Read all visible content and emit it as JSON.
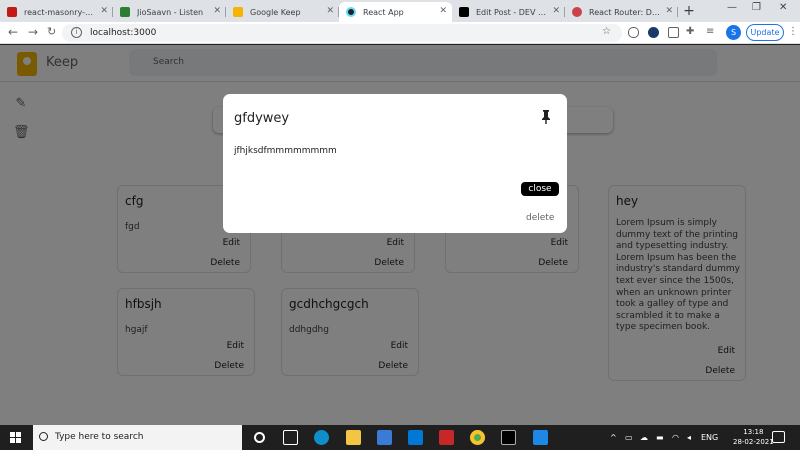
{
  "browser": {
    "tabs": [
      {
        "label": "react-masonry-css - n",
        "color": "#c41a16"
      },
      {
        "label": "JioSaavn - Listen",
        "color": "#2e7d32"
      },
      {
        "label": "Google Keep",
        "color": "#f4b400"
      },
      {
        "label": "React App",
        "color": "#61dafb"
      },
      {
        "label": "Edit Post - DEV Comm",
        "color": "#000000"
      },
      {
        "label": "React Router: Declar",
        "color": "#ca4245"
      }
    ],
    "new_tab": "+",
    "url": "localhost:3000",
    "profile_initial": "S",
    "update_label": "Update"
  },
  "app": {
    "brand": "Keep",
    "search_placeholder": "Search",
    "notes": [
      {
        "title": "cfg",
        "body": "fgd",
        "edit": "Edit",
        "delete": "Delete"
      },
      {
        "title": "",
        "body": "",
        "edit": "Edit",
        "delete": "Delete"
      },
      {
        "title": "",
        "body": "",
        "edit": "Edit",
        "delete": "Delete"
      },
      {
        "title": "hey",
        "body": "Lorem Ipsum is simply dummy text of the printing and typesetting industry. Lorem Ipsum has been the industry's standard dummy text ever since the 1500s, when an unknown printer took a galley of type and scrambled it to make a type specimen book.",
        "edit": "Edit",
        "delete": "Delete"
      },
      {
        "title": "hfbsjh",
        "body": "hgajf",
        "edit": "Edit",
        "delete": "Delete"
      },
      {
        "title": "gcdhchgcgch",
        "body": "ddhgdhg",
        "edit": "Edit",
        "delete": "Delete"
      }
    ]
  },
  "modal": {
    "title": "gfdywey",
    "body": "jfhjksdfmmmmmmmm",
    "close_label": "close",
    "delete_label": "delete"
  },
  "taskbar": {
    "search_placeholder": "Type here to search",
    "language": "ENG",
    "time": "13:18",
    "date": "28-02-2021"
  }
}
